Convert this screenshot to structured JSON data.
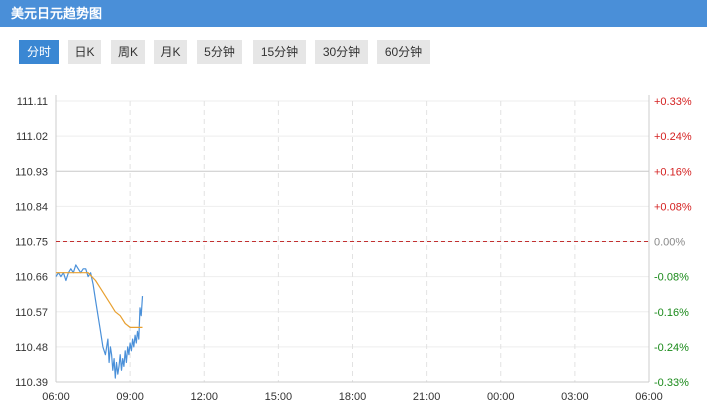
{
  "window": {
    "title": "美元日元趋势图"
  },
  "tabs": [
    {
      "label": "分时",
      "active": true
    },
    {
      "label": "日K",
      "active": false
    },
    {
      "label": "周K",
      "active": false
    },
    {
      "label": "月K",
      "active": false
    },
    {
      "label": "5分钟",
      "active": false
    },
    {
      "label": "15分钟",
      "active": false
    },
    {
      "label": "30分钟",
      "active": false
    },
    {
      "label": "60分钟",
      "active": false
    }
  ],
  "colors": {
    "accent": "#3a87d3",
    "title_bg": "#4a8fd8",
    "up": "#d42020",
    "down": "#1a8a1a",
    "neutral": "#888888",
    "price_line": "#4a90d9",
    "avg_line": "#e8a030",
    "base_line": "#c23030"
  },
  "chart_data": {
    "type": "line",
    "x_ticks": [
      "06:00",
      "09:00",
      "12:00",
      "15:00",
      "18:00",
      "21:00",
      "00:00",
      "03:00",
      "06:00"
    ],
    "y_left_ticks": [
      "111.11",
      "111.02",
      "110.93",
      "110.84",
      "110.75",
      "110.66",
      "110.57",
      "110.48",
      "110.39"
    ],
    "y_right_ticks": [
      "+0.33%",
      "+0.24%",
      "+0.16%",
      "+0.08%",
      "0.00%",
      "-0.08%",
      "-0.16%",
      "-0.24%",
      "-0.33%"
    ],
    "right_tick_tone": [
      "up",
      "up",
      "up",
      "up",
      "neutral",
      "down",
      "down",
      "down",
      "down"
    ],
    "ylim": [
      110.39,
      111.11
    ],
    "baseline": 110.75,
    "x_range_hours": [
      0,
      24
    ],
    "series": [
      {
        "key": "price",
        "x": [
          0,
          0.1,
          0.2,
          0.3,
          0.4,
          0.5,
          0.6,
          0.7,
          0.8,
          0.9,
          1.0,
          1.1,
          1.2,
          1.3,
          1.4,
          1.5,
          1.6,
          1.7,
          1.8,
          1.9,
          2.0,
          2.1,
          2.15,
          2.2,
          2.25,
          2.3,
          2.35,
          2.4,
          2.45,
          2.5,
          2.55,
          2.6,
          2.65,
          2.7,
          2.75,
          2.8,
          2.85,
          2.9,
          2.95,
          3.0,
          3.05,
          3.1,
          3.15,
          3.2,
          3.25,
          3.3,
          3.35,
          3.4,
          3.45,
          3.5
        ],
        "values": [
          110.66,
          110.67,
          110.66,
          110.67,
          110.65,
          110.67,
          110.68,
          110.67,
          110.69,
          110.68,
          110.67,
          110.68,
          110.68,
          110.66,
          110.67,
          110.64,
          110.6,
          110.56,
          110.52,
          110.48,
          110.46,
          110.5,
          110.44,
          110.48,
          110.46,
          110.42,
          110.45,
          110.4,
          110.44,
          110.41,
          110.43,
          110.46,
          110.42,
          110.45,
          110.43,
          110.47,
          110.44,
          110.48,
          110.46,
          110.49,
          110.47,
          110.5,
          110.48,
          110.51,
          110.49,
          110.52,
          110.5,
          110.58,
          110.56,
          110.61
        ]
      },
      {
        "key": "average",
        "x": [
          0,
          0.5,
          1.0,
          1.3,
          1.6,
          1.8,
          2.0,
          2.2,
          2.4,
          2.6,
          2.8,
          3.0,
          3.2,
          3.5
        ],
        "values": [
          110.67,
          110.67,
          110.67,
          110.67,
          110.65,
          110.63,
          110.61,
          110.59,
          110.57,
          110.56,
          110.54,
          110.53,
          110.53,
          110.53
        ]
      }
    ],
    "grid": true,
    "legend": "none"
  }
}
